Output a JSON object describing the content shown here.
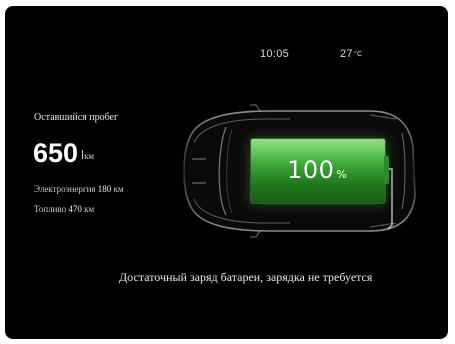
{
  "status": {
    "time": "10:05",
    "temperature": "27",
    "temperature_unit": "°C"
  },
  "range": {
    "label": "Оставшийся пробег",
    "value": "650",
    "unit": "км",
    "electric_label": "Электроэнергия",
    "electric_value": "180",
    "electric_unit": "км",
    "fuel_label": "Топливо",
    "fuel_value": "470",
    "fuel_unit": "км"
  },
  "battery": {
    "level": "100",
    "level_unit": "%",
    "level_fraction": 1.0,
    "fill_color": "#3fae37",
    "accent_color": "#7bdc6b"
  },
  "message": "Достаточный заряд батареи, зарядка не требуется",
  "icons": [
    "car-top-view-icon",
    "battery-icon",
    "charging-cable-icon"
  ]
}
